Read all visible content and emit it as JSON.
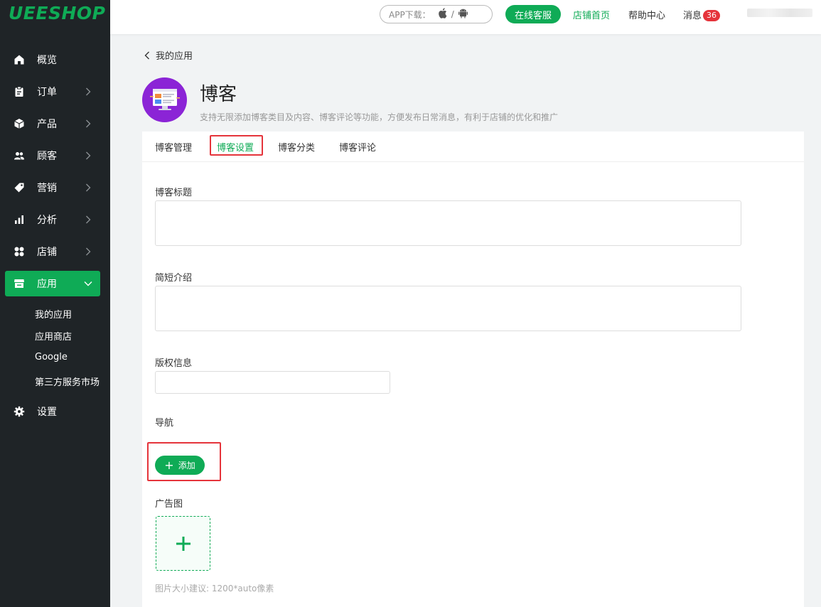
{
  "brand": {
    "logo": "UEESHOP",
    "accent": "#0fab56",
    "sidebar_bg": "#1f2427",
    "highlight": "#e5343b"
  },
  "topbar": {
    "app_download_label": "APP下载：",
    "app_sep": "/",
    "service_button": "在线客服",
    "store_home": "店铺首页",
    "help_center": "帮助中心",
    "messages_label": "消息",
    "messages_count": "36"
  },
  "sidebar": {
    "items": [
      {
        "label": "概览",
        "icon": "home-icon"
      },
      {
        "label": "订单",
        "icon": "clipboard-icon"
      },
      {
        "label": "产品",
        "icon": "box-icon"
      },
      {
        "label": "顾客",
        "icon": "users-icon"
      },
      {
        "label": "营销",
        "icon": "tag-icon"
      },
      {
        "label": "分析",
        "icon": "bar-chart-icon"
      },
      {
        "label": "店铺",
        "icon": "grid-icon"
      },
      {
        "label": "应用",
        "icon": "store-icon"
      },
      {
        "label": "设置",
        "icon": "gear-icon"
      }
    ],
    "sub_items": [
      {
        "label": "我的应用"
      },
      {
        "label": "应用商店"
      },
      {
        "label": "Google"
      },
      {
        "label": "第三方服务市场"
      }
    ]
  },
  "header": {
    "back_label": "我的应用",
    "app_title": "博客",
    "app_desc": "支持无限添加博客类目及内容、博客评论等功能，方便发布日常消息，有利于店铺的优化和推广"
  },
  "tabs": [
    {
      "label": "博客管理"
    },
    {
      "label": "博客设置"
    },
    {
      "label": "博客分类"
    },
    {
      "label": "博客评论"
    }
  ],
  "form": {
    "title_label": "博客标题",
    "title_value": "",
    "intro_label": "简短介绍",
    "intro_value": "",
    "copyright_label": "版权信息",
    "copyright_value": "",
    "nav_label": "导航",
    "add_button": "添加",
    "ad_label": "广告图",
    "ad_hint": "图片大小建议: 1200*auto像素"
  }
}
